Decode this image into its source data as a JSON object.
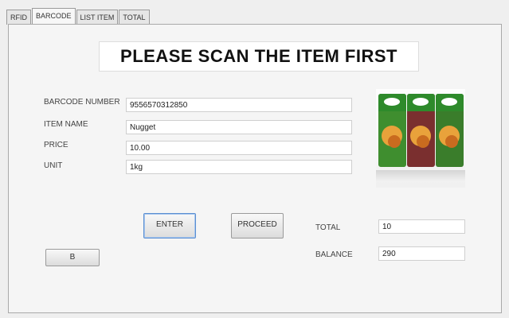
{
  "tabs": [
    {
      "label": "RFID"
    },
    {
      "label": "BARCODE"
    },
    {
      "label": "LIST ITEM"
    },
    {
      "label": "TOTAL"
    }
  ],
  "headline": "PLEASE SCAN THE ITEM FIRST",
  "form": {
    "barcode_label": "BARCODE NUMBER",
    "barcode_value": "9556570312850",
    "item_name_label": "ITEM NAME",
    "item_name_value": "Nugget",
    "price_label": "PRICE",
    "price_value": "10.00",
    "unit_label": "UNIT",
    "unit_value": "1kg"
  },
  "buttons": {
    "enter": "ENTER",
    "proceed": "PROCEED",
    "b": "B"
  },
  "summary": {
    "total_label": "TOTAL",
    "total_value": "10",
    "balance_label": "BALANCE",
    "balance_value": "290"
  },
  "colors": {
    "pack_left": "#3f8e2f",
    "pack_mid": "#7a2f2f",
    "pack_right": "#3a7d2b"
  }
}
